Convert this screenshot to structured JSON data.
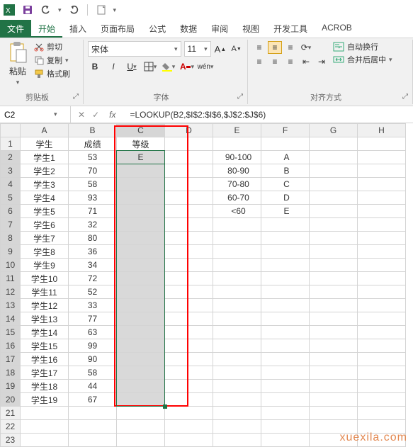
{
  "qat": {
    "save_icon": "save",
    "undo_icon": "undo",
    "redo_icon": "redo",
    "new_icon": "new"
  },
  "menu": {
    "file": "文件",
    "home": "开始",
    "insert": "插入",
    "layout": "页面布局",
    "formulas": "公式",
    "data": "数据",
    "review": "审阅",
    "view": "视图",
    "dev": "开发工具",
    "acrob": "ACROB"
  },
  "ribbon": {
    "clipboard": {
      "label": "剪贴板",
      "paste": "粘贴",
      "cut": "剪切",
      "copy": "复制",
      "painter": "格式刷"
    },
    "font": {
      "label": "字体",
      "name": "宋体",
      "size": "11",
      "bold": "B",
      "italic": "I",
      "underline": "U",
      "more": "wén"
    },
    "align": {
      "label": "对齐方式",
      "wrap": "自动换行",
      "merge": "合并后居中"
    }
  },
  "namebox": "C2",
  "formula": "=LOOKUP(B2,$I$2:$I$6,$J$2:$J$6)",
  "cols": [
    "A",
    "B",
    "C",
    "D",
    "E",
    "F",
    "G",
    "H"
  ],
  "rows": [
    {
      "r": "1",
      "A": "学生",
      "B": "成绩",
      "C": "等级",
      "E": "",
      "F": ""
    },
    {
      "r": "2",
      "A": "学生1",
      "B": "53",
      "C": "E",
      "E": "90-100",
      "F": "A"
    },
    {
      "r": "3",
      "A": "学生2",
      "B": "70",
      "C": "",
      "E": "80-90",
      "F": "B"
    },
    {
      "r": "4",
      "A": "学生3",
      "B": "58",
      "C": "",
      "E": "70-80",
      "F": "C"
    },
    {
      "r": "5",
      "A": "学生4",
      "B": "93",
      "C": "",
      "E": "60-70",
      "F": "D"
    },
    {
      "r": "6",
      "A": "学生5",
      "B": "71",
      "C": "",
      "E": "<60",
      "F": "E"
    },
    {
      "r": "7",
      "A": "学生6",
      "B": "32",
      "C": ""
    },
    {
      "r": "8",
      "A": "学生7",
      "B": "80",
      "C": ""
    },
    {
      "r": "9",
      "A": "学生8",
      "B": "36",
      "C": ""
    },
    {
      "r": "10",
      "A": "学生9",
      "B": "34",
      "C": ""
    },
    {
      "r": "11",
      "A": "学生10",
      "B": "72",
      "C": ""
    },
    {
      "r": "12",
      "A": "学生11",
      "B": "52",
      "C": ""
    },
    {
      "r": "13",
      "A": "学生12",
      "B": "33",
      "C": ""
    },
    {
      "r": "14",
      "A": "学生13",
      "B": "77",
      "C": ""
    },
    {
      "r": "15",
      "A": "学生14",
      "B": "63",
      "C": ""
    },
    {
      "r": "16",
      "A": "学生15",
      "B": "99",
      "C": ""
    },
    {
      "r": "17",
      "A": "学生16",
      "B": "90",
      "C": ""
    },
    {
      "r": "18",
      "A": "学生17",
      "B": "58",
      "C": ""
    },
    {
      "r": "19",
      "A": "学生18",
      "B": "44",
      "C": ""
    },
    {
      "r": "20",
      "A": "学生19",
      "B": "67",
      "C": ""
    },
    {
      "r": "21"
    },
    {
      "r": "22"
    },
    {
      "r": "23"
    }
  ],
  "watermark": "xuexila.com"
}
